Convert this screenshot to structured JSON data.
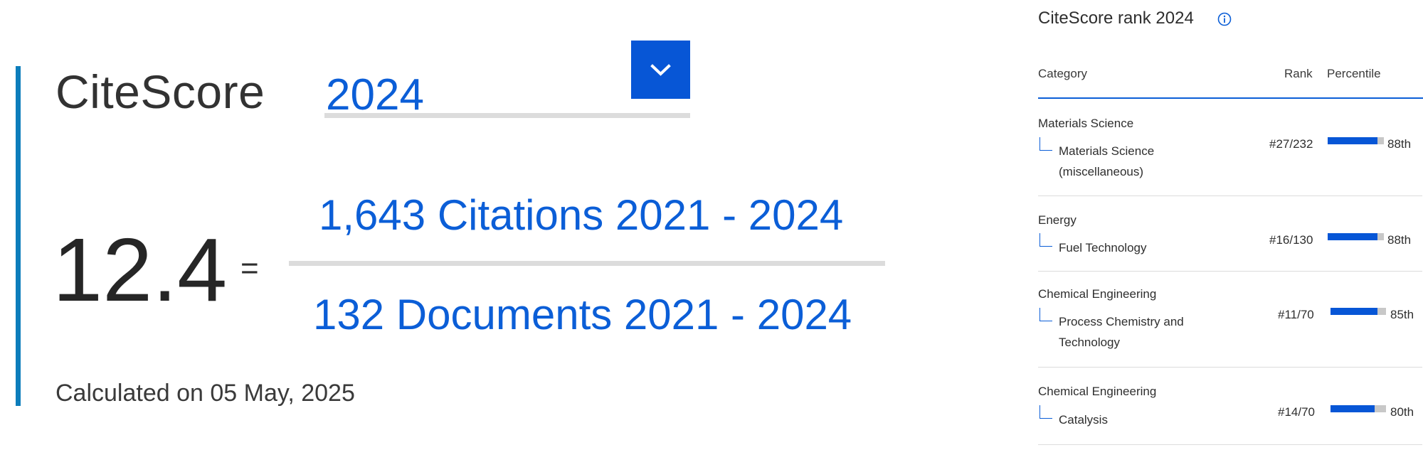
{
  "citescore": {
    "label": "CiteScore",
    "year_selected": "2024",
    "score": "12.4",
    "equals": "=",
    "citations_text": "1,643 Citations 2021 - 2024",
    "documents_text": "132 Documents 2021 - 2024",
    "calculated": "Calculated on 05 May, 2025"
  },
  "rank_panel": {
    "title": "CiteScore rank 2024",
    "headers": {
      "category": "Category",
      "rank": "Rank",
      "percentile": "Percentile"
    },
    "rows": [
      {
        "category": "Materials Science",
        "subcategory": "Materials Science (miscellaneous)",
        "rank": "#27/232",
        "percentile": "88th",
        "percentile_value": 88
      },
      {
        "category": "Energy",
        "subcategory": "Fuel Technology",
        "rank": "#16/130",
        "percentile": "88th",
        "percentile_value": 88
      },
      {
        "category": "Chemical Engineering",
        "subcategory": "Process Chemistry and Technology",
        "rank": "#11/70",
        "percentile": "85th",
        "percentile_value": 85
      },
      {
        "category": "Chemical Engineering",
        "subcategory": "Catalysis",
        "rank": "#14/70",
        "percentile": "80th",
        "percentile_value": 80
      }
    ]
  },
  "colors": {
    "accent": "#0756d6",
    "link": "#0b5ed7",
    "side_bar": "#0c7dbb",
    "bar_track": "#c8c8c8"
  },
  "icons": {
    "dropdown": "chevron-down-icon",
    "info": "info-icon"
  }
}
